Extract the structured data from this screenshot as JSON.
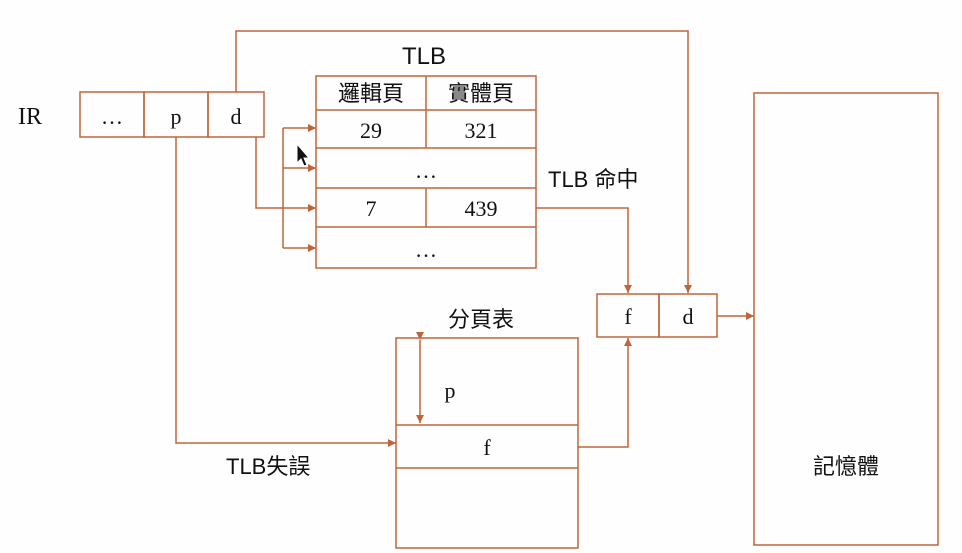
{
  "ir": {
    "label": "IR",
    "cells": [
      "…",
      "p",
      "d"
    ]
  },
  "tlb": {
    "title": "TLB",
    "headers": [
      "邏輯頁",
      "實體頁"
    ],
    "rows": [
      [
        "29",
        "321"
      ],
      [
        "…",
        ""
      ],
      [
        "7",
        "439"
      ],
      [
        "…",
        ""
      ]
    ],
    "hit_label": "TLB 命中"
  },
  "page_table": {
    "title": "分頁表",
    "offset_label": "p",
    "entry_label": "f",
    "miss_label": "TLB失誤"
  },
  "physical_address": {
    "cells": [
      "f",
      "d"
    ]
  },
  "memory": {
    "label": "記憶體"
  },
  "colors": {
    "line": "#c0643c",
    "text": "#111111",
    "background": "#fefefe"
  }
}
